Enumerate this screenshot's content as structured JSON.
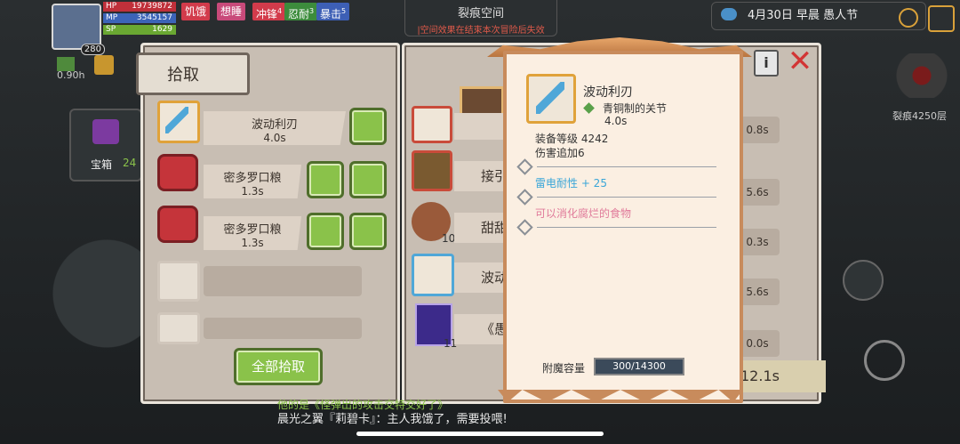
{
  "status": {
    "level": "280",
    "hp_label": "HP",
    "hp_value": "19739872",
    "mp_label": "MP",
    "mp_value": "3545157",
    "sp_label": "SP",
    "sp_value": "1629"
  },
  "buffs": [
    {
      "label": "饥饿",
      "color": "#d23b4b"
    },
    {
      "label": "想睡",
      "color": "#c84a7a"
    },
    {
      "label": "冲锋",
      "color": "#d23b4b",
      "count": "4"
    },
    {
      "label": "忍耐",
      "color": "#3c8c3c",
      "count": "3"
    },
    {
      "label": "暴击",
      "color": "#3d5fb5",
      "count": "5"
    }
  ],
  "top_center": {
    "title": "裂痕空间",
    "subtitle": "|空间效果在结束本次冒险后失效"
  },
  "date_bar": {
    "text": "4月30日  早晨  愚人节"
  },
  "left_hud": {
    "timer": "0.90h",
    "chest_label": "宝箱",
    "chest_count": "24"
  },
  "right_hud": {
    "floor_label": "裂痕4250层"
  },
  "pickup_panel": {
    "title": "拾取",
    "items": [
      {
        "name": "波动利刃",
        "time": "4.0s"
      },
      {
        "name": "密多罗口粮",
        "time": "1.3s"
      },
      {
        "name": "密多罗口粮",
        "time": "1.3s"
      }
    ],
    "pickup_all_label": "全部拾取"
  },
  "middle_panel": {
    "items": [
      {
        "name": "",
        "time": "0.8s"
      },
      {
        "name": "接引",
        "time": "5.6s"
      },
      {
        "name": "甜甜",
        "time": "0.3s",
        "count": "10"
      },
      {
        "name": "波动",
        "time": "5.6s"
      },
      {
        "name": "《愚",
        "time": "0.0s",
        "count": "11"
      }
    ],
    "bottom_time": "12.1s"
  },
  "tooltip": {
    "item_name": "波动利刃",
    "subtype": "青铜制的关节",
    "time": "4.0s",
    "equip_level_label": "装备等级",
    "equip_level": "4242",
    "damage_bonus": "伤害追加6",
    "stat_line": "雷电耐性 + 25",
    "stat_color": "#3aa6d8",
    "effect_line": "可以消化腐烂的食物",
    "effect_color": "#e07a9a",
    "enchant_label": "附魔容量",
    "enchant_value": "300/14300"
  },
  "chat": {
    "line1": "他的是《怪弹出的攻击交特交好了》",
    "line2": "晨光之翼『莉碧卡』：主人我饿了，需要投喂!"
  }
}
